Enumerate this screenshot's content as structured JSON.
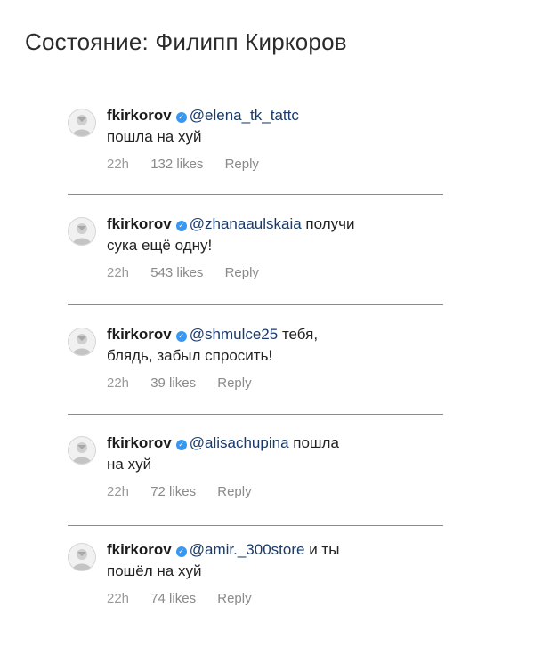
{
  "title": "Состояние: Филипп Киркоров",
  "comments": [
    {
      "username": "fkirkorov",
      "mention": "@elena_tk_tattc",
      "text_line1": "",
      "text_line2": "пошла на хуй",
      "time": "22h",
      "likes": "132 likes",
      "reply": "Reply"
    },
    {
      "username": "fkirkorov",
      "mention": "@zhanaaulskaia",
      "text_line1": " получи",
      "text_line2": "сука ещё одну!",
      "time": "22h",
      "likes": "543 likes",
      "reply": "Reply"
    },
    {
      "username": "fkirkorov",
      "mention": "@shmulce25",
      "text_line1": " тебя,",
      "text_line2": "блядь, забыл спросить!",
      "time": "22h",
      "likes": "39 likes",
      "reply": "Reply"
    },
    {
      "username": "fkirkorov",
      "mention": "@alisachupina",
      "text_line1": " пошла",
      "text_line2": "на хуй",
      "time": "22h",
      "likes": "72 likes",
      "reply": "Reply"
    },
    {
      "username": "fkirkorov",
      "mention": "@amir._300store",
      "text_line1": " и ты",
      "text_line2": "пошёл на хуй",
      "time": "22h",
      "likes": "74 likes",
      "reply": "Reply"
    }
  ],
  "icons": {
    "verified": "verified-badge-icon",
    "avatar": "avatar"
  },
  "colors": {
    "verified": "#3897f0",
    "meta": "#9a9a9a"
  }
}
